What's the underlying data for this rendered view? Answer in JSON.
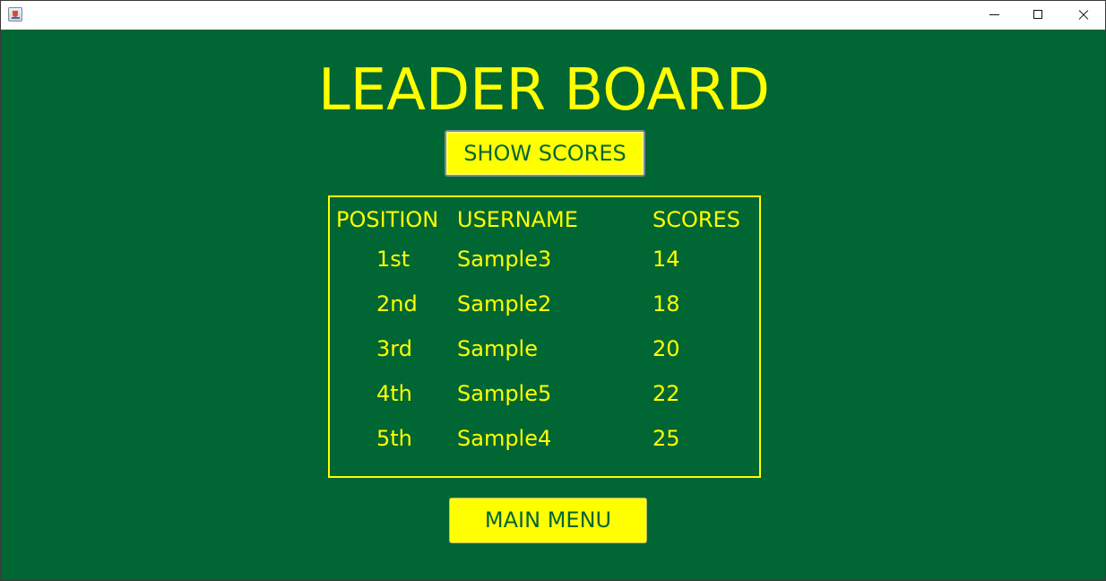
{
  "window": {
    "icon": "java-coffee-cup-icon",
    "controls": [
      "minimize-icon",
      "maximize-icon",
      "close-icon"
    ]
  },
  "colors": {
    "background": "#006633",
    "accent": "#ffff00",
    "button_text": "#006633"
  },
  "title": "LEADER BOARD",
  "show_scores_label": "SHOW SCORES",
  "main_menu_label": "MAIN MENU",
  "board": {
    "headers": {
      "position": "POSITION",
      "username": "USERNAME",
      "scores": "SCORES"
    },
    "rows": [
      {
        "position": "1st",
        "username": "Sample3",
        "score": "14"
      },
      {
        "position": "2nd",
        "username": "Sample2",
        "score": "18"
      },
      {
        "position": "3rd",
        "username": "Sample",
        "score": "20"
      },
      {
        "position": "4th",
        "username": "Sample5",
        "score": "22"
      },
      {
        "position": "5th",
        "username": "Sample4",
        "score": "25"
      }
    ]
  }
}
